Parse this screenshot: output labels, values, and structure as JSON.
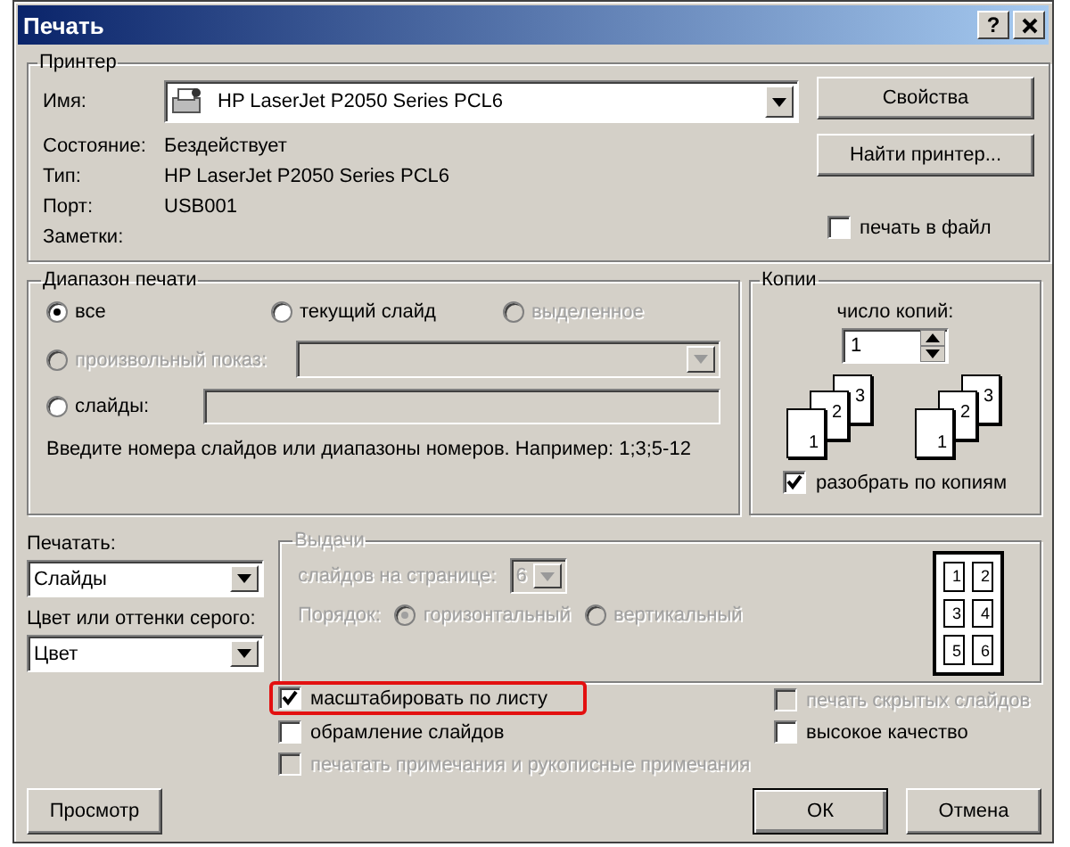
{
  "window": {
    "title": "Печать",
    "help": "?"
  },
  "printer": {
    "title": "Принтер",
    "name_label": "Имя:",
    "name_value": "HP LaserJet P2050 Series PCL6",
    "status_label": "Состояние:",
    "status_value": "Бездействует",
    "type_label": "Тип:",
    "type_value": "HP LaserJet P2050 Series PCL6",
    "port_label": "Порт:",
    "port_value": "USB001",
    "notes_label": "Заметки:",
    "properties_button": "Свойства",
    "find_button": "Найти принтер...",
    "print_to_file": {
      "label": "печать в файл",
      "checked": false
    }
  },
  "range": {
    "title": "Диапазон печати",
    "options": [
      {
        "label": "все",
        "selected": true,
        "disabled": false
      },
      {
        "label": "текущий слайд",
        "selected": false,
        "disabled": false
      },
      {
        "label": "выделенное",
        "selected": false,
        "disabled": true
      },
      {
        "label": "произвольный показ:",
        "selected": false,
        "disabled": true
      },
      {
        "label": "слайды:",
        "selected": false,
        "disabled": false
      }
    ],
    "hint": "Введите номера слайдов или диапазоны номеров. Например: 1;3;5-12"
  },
  "copies": {
    "title": "Копии",
    "count_label": "число копий:",
    "count_value": "1",
    "stacks": [
      [
        "1",
        "2",
        "3"
      ],
      [
        "1",
        "2",
        "3"
      ]
    ],
    "collate": {
      "label": "разобрать по копиям",
      "checked": true
    }
  },
  "print_what": {
    "label": "Печатать:",
    "value": "Слайды"
  },
  "color": {
    "label": "Цвет или оттенки серого:",
    "value": "Цвет"
  },
  "handouts": {
    "title": "Выдачи",
    "disabled": true,
    "per_page_label": "слайдов на странице:",
    "per_page_value": "6",
    "order_label": "Порядок:",
    "orders": [
      {
        "label": "горизонтальный",
        "selected": true
      },
      {
        "label": "вертикальный",
        "selected": false
      }
    ],
    "preview_numbers": [
      "1",
      "2",
      "3",
      "4",
      "5",
      "6"
    ]
  },
  "left_checks": [
    {
      "label": "масштабировать по листу",
      "checked": true,
      "disabled": false,
      "highlighted": true
    },
    {
      "label": "обрамление слайдов",
      "checked": false,
      "disabled": false,
      "highlighted": false
    },
    {
      "label": "печатать примечания и рукописные примечания",
      "checked": false,
      "disabled": true,
      "highlighted": false
    }
  ],
  "right_checks": [
    {
      "label": "печать скрытых слайдов",
      "checked": false,
      "disabled": true,
      "highlighted": false
    },
    {
      "label": "высокое качество",
      "checked": false,
      "disabled": false,
      "highlighted": false
    }
  ],
  "buttons": {
    "preview": "Просмотр",
    "ok": "ОК",
    "cancel": "Отмена"
  }
}
